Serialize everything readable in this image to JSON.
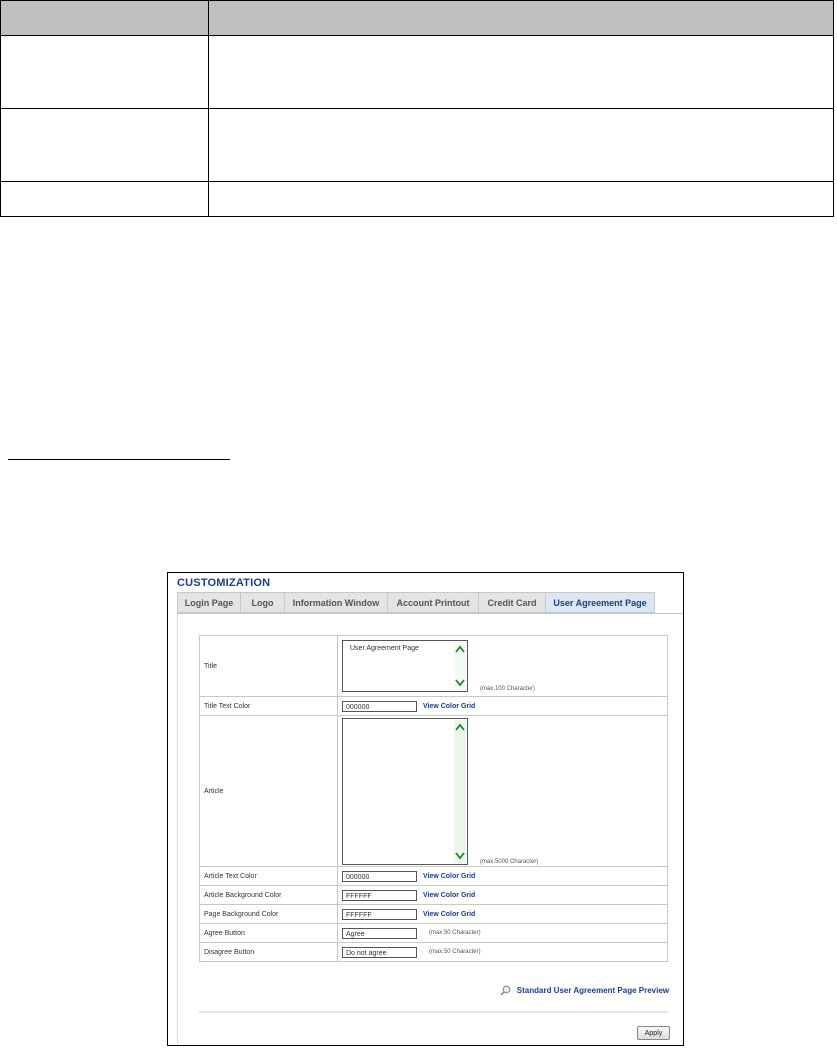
{
  "customization": {
    "title": "CUSTOMIZATION",
    "tabs": [
      {
        "label": "Login Page",
        "active": false
      },
      {
        "label": "Logo",
        "active": false
      },
      {
        "label": "Information Window",
        "active": false
      },
      {
        "label": "Account Printout",
        "active": false
      },
      {
        "label": "Credit Card",
        "active": false
      },
      {
        "label": "User Agreement Page",
        "active": true
      }
    ],
    "rows": {
      "title": {
        "label": "Title",
        "value": "User Agreement Page",
        "note": "(max.100 Character)"
      },
      "title_text_color": {
        "label": "Title Text Color",
        "value": "000000",
        "link": "View Color Grid"
      },
      "article": {
        "label": "Article",
        "value": "",
        "note": "(max.5000 Character)"
      },
      "article_text_color": {
        "label": "Article Text Color",
        "value": "000000",
        "link": "View Color Grid"
      },
      "article_bg_color": {
        "label": "Article Background Color",
        "value": "FFFFFF",
        "link": "View Color Grid"
      },
      "page_bg_color": {
        "label": "Page Background Color",
        "value": "FFFFFF",
        "link": "View Color Grid"
      },
      "agree_button": {
        "label": "Agree Button",
        "value": "Agree",
        "note": "(max.50 Character)"
      },
      "disagree_button": {
        "label": "Disagree Button",
        "value": "Do not agree",
        "note": "(max.50 Character)"
      }
    },
    "preview_link": "Standard User Agreement Page Preview",
    "apply_label": "Apply"
  },
  "icons": {
    "scroll_up": "chevron-up-icon",
    "scroll_down": "chevron-down-icon",
    "preview": "magnifier-icon"
  },
  "colors": {
    "heading_blue": "#1f3d8a",
    "header_gray": "#bfbfbf",
    "tab_active_bg": "#dde6f3",
    "scroll_arrow": "#2e7d32"
  }
}
